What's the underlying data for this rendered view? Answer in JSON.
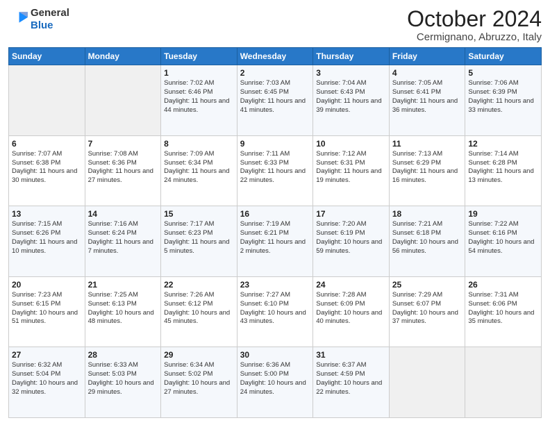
{
  "logo": {
    "general": "General",
    "blue": "Blue"
  },
  "header": {
    "title": "October 2024",
    "location": "Cermignano, Abruzzo, Italy"
  },
  "columns": [
    "Sunday",
    "Monday",
    "Tuesday",
    "Wednesday",
    "Thursday",
    "Friday",
    "Saturday"
  ],
  "weeks": [
    [
      {
        "day": "",
        "info": ""
      },
      {
        "day": "",
        "info": ""
      },
      {
        "day": "1",
        "info": "Sunrise: 7:02 AM\nSunset: 6:46 PM\nDaylight: 11 hours and 44 minutes."
      },
      {
        "day": "2",
        "info": "Sunrise: 7:03 AM\nSunset: 6:45 PM\nDaylight: 11 hours and 41 minutes."
      },
      {
        "day": "3",
        "info": "Sunrise: 7:04 AM\nSunset: 6:43 PM\nDaylight: 11 hours and 39 minutes."
      },
      {
        "day": "4",
        "info": "Sunrise: 7:05 AM\nSunset: 6:41 PM\nDaylight: 11 hours and 36 minutes."
      },
      {
        "day": "5",
        "info": "Sunrise: 7:06 AM\nSunset: 6:39 PM\nDaylight: 11 hours and 33 minutes."
      }
    ],
    [
      {
        "day": "6",
        "info": "Sunrise: 7:07 AM\nSunset: 6:38 PM\nDaylight: 11 hours and 30 minutes."
      },
      {
        "day": "7",
        "info": "Sunrise: 7:08 AM\nSunset: 6:36 PM\nDaylight: 11 hours and 27 minutes."
      },
      {
        "day": "8",
        "info": "Sunrise: 7:09 AM\nSunset: 6:34 PM\nDaylight: 11 hours and 24 minutes."
      },
      {
        "day": "9",
        "info": "Sunrise: 7:11 AM\nSunset: 6:33 PM\nDaylight: 11 hours and 22 minutes."
      },
      {
        "day": "10",
        "info": "Sunrise: 7:12 AM\nSunset: 6:31 PM\nDaylight: 11 hours and 19 minutes."
      },
      {
        "day": "11",
        "info": "Sunrise: 7:13 AM\nSunset: 6:29 PM\nDaylight: 11 hours and 16 minutes."
      },
      {
        "day": "12",
        "info": "Sunrise: 7:14 AM\nSunset: 6:28 PM\nDaylight: 11 hours and 13 minutes."
      }
    ],
    [
      {
        "day": "13",
        "info": "Sunrise: 7:15 AM\nSunset: 6:26 PM\nDaylight: 11 hours and 10 minutes."
      },
      {
        "day": "14",
        "info": "Sunrise: 7:16 AM\nSunset: 6:24 PM\nDaylight: 11 hours and 7 minutes."
      },
      {
        "day": "15",
        "info": "Sunrise: 7:17 AM\nSunset: 6:23 PM\nDaylight: 11 hours and 5 minutes."
      },
      {
        "day": "16",
        "info": "Sunrise: 7:19 AM\nSunset: 6:21 PM\nDaylight: 11 hours and 2 minutes."
      },
      {
        "day": "17",
        "info": "Sunrise: 7:20 AM\nSunset: 6:19 PM\nDaylight: 10 hours and 59 minutes."
      },
      {
        "day": "18",
        "info": "Sunrise: 7:21 AM\nSunset: 6:18 PM\nDaylight: 10 hours and 56 minutes."
      },
      {
        "day": "19",
        "info": "Sunrise: 7:22 AM\nSunset: 6:16 PM\nDaylight: 10 hours and 54 minutes."
      }
    ],
    [
      {
        "day": "20",
        "info": "Sunrise: 7:23 AM\nSunset: 6:15 PM\nDaylight: 10 hours and 51 minutes."
      },
      {
        "day": "21",
        "info": "Sunrise: 7:25 AM\nSunset: 6:13 PM\nDaylight: 10 hours and 48 minutes."
      },
      {
        "day": "22",
        "info": "Sunrise: 7:26 AM\nSunset: 6:12 PM\nDaylight: 10 hours and 45 minutes."
      },
      {
        "day": "23",
        "info": "Sunrise: 7:27 AM\nSunset: 6:10 PM\nDaylight: 10 hours and 43 minutes."
      },
      {
        "day": "24",
        "info": "Sunrise: 7:28 AM\nSunset: 6:09 PM\nDaylight: 10 hours and 40 minutes."
      },
      {
        "day": "25",
        "info": "Sunrise: 7:29 AM\nSunset: 6:07 PM\nDaylight: 10 hours and 37 minutes."
      },
      {
        "day": "26",
        "info": "Sunrise: 7:31 AM\nSunset: 6:06 PM\nDaylight: 10 hours and 35 minutes."
      }
    ],
    [
      {
        "day": "27",
        "info": "Sunrise: 6:32 AM\nSunset: 5:04 PM\nDaylight: 10 hours and 32 minutes."
      },
      {
        "day": "28",
        "info": "Sunrise: 6:33 AM\nSunset: 5:03 PM\nDaylight: 10 hours and 29 minutes."
      },
      {
        "day": "29",
        "info": "Sunrise: 6:34 AM\nSunset: 5:02 PM\nDaylight: 10 hours and 27 minutes."
      },
      {
        "day": "30",
        "info": "Sunrise: 6:36 AM\nSunset: 5:00 PM\nDaylight: 10 hours and 24 minutes."
      },
      {
        "day": "31",
        "info": "Sunrise: 6:37 AM\nSunset: 4:59 PM\nDaylight: 10 hours and 22 minutes."
      },
      {
        "day": "",
        "info": ""
      },
      {
        "day": "",
        "info": ""
      }
    ]
  ]
}
